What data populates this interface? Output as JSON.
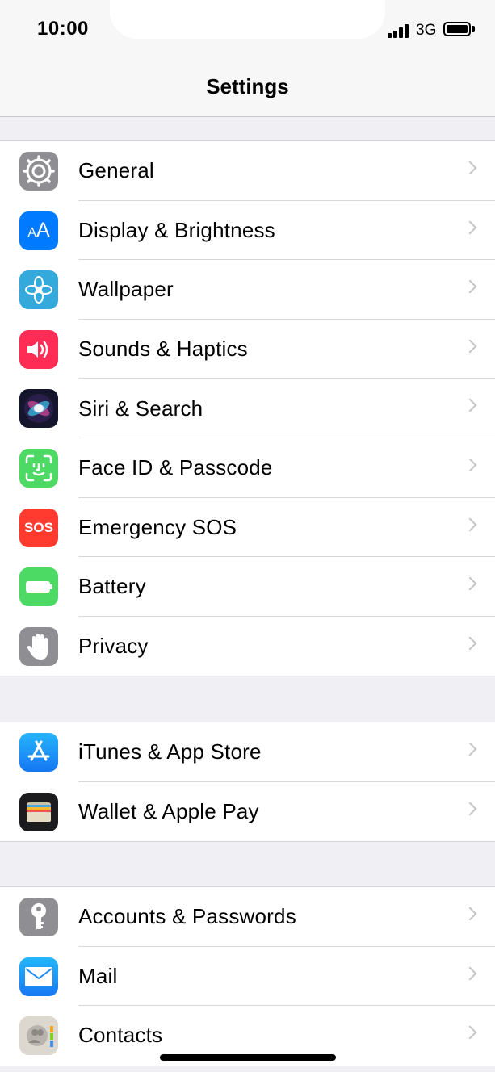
{
  "status": {
    "time": "10:00",
    "network": "3G"
  },
  "nav": {
    "title": "Settings"
  },
  "groups": [
    {
      "items": [
        {
          "label": "General",
          "icon": "gear-icon",
          "color": "#8e8e93"
        },
        {
          "label": "Display & Brightness",
          "icon": "display-aa-icon",
          "color": "#007aff"
        },
        {
          "label": "Wallpaper",
          "icon": "flower-icon",
          "color": "#34aadc"
        },
        {
          "label": "Sounds & Haptics",
          "icon": "speaker-icon",
          "color": "#ff2d55"
        },
        {
          "label": "Siri & Search",
          "icon": "siri-icon",
          "color": "#1c1c3c"
        },
        {
          "label": "Face ID & Passcode",
          "icon": "face-id-icon",
          "color": "#4cd964"
        },
        {
          "label": "Emergency SOS",
          "icon": "sos-icon",
          "color": "#ff3b30",
          "icon_text": "SOS"
        },
        {
          "label": "Battery",
          "icon": "battery-icon",
          "color": "#4cd964"
        },
        {
          "label": "Privacy",
          "icon": "hand-icon",
          "color": "#8e8e93"
        }
      ]
    },
    {
      "items": [
        {
          "label": "iTunes & App Store",
          "icon": "app-store-icon",
          "color": "#1a8cff"
        },
        {
          "label": "Wallet & Apple Pay",
          "icon": "wallet-icon",
          "color": "#1c1c1e"
        }
      ]
    },
    {
      "items": [
        {
          "label": "Accounts & Passwords",
          "icon": "key-icon",
          "color": "#8e8e93"
        },
        {
          "label": "Mail",
          "icon": "mail-icon",
          "color": "#1a8cff"
        },
        {
          "label": "Contacts",
          "icon": "contacts-icon",
          "color": "#d9d6cf"
        }
      ]
    }
  ]
}
